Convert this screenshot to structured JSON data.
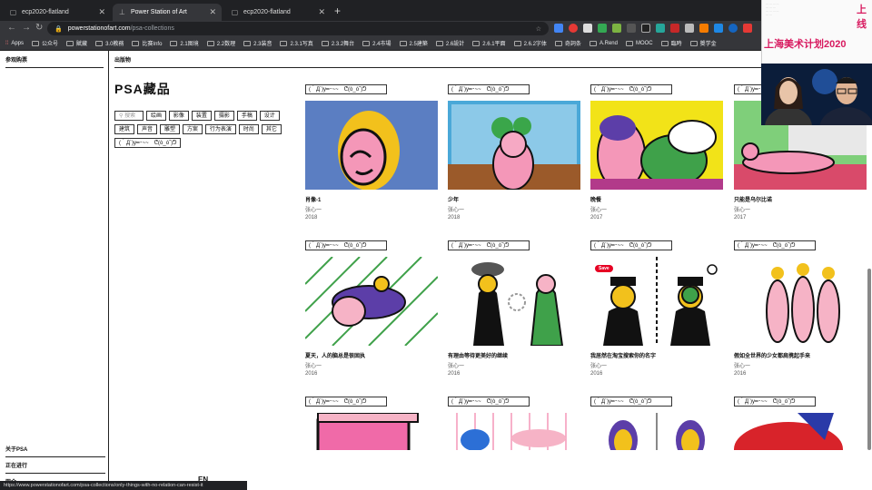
{
  "browser": {
    "tabs": [
      {
        "title": "ecp2020-flatland",
        "active": false
      },
      {
        "title": "Power Station of Art",
        "active": true
      },
      {
        "title": "ecp2020-flatland",
        "active": false
      }
    ],
    "url_host": "powerstationofart.com",
    "url_path": "/psa-collections",
    "bookmarks": [
      "Apps",
      "公众号",
      "賦藏",
      "3.0教務",
      "比赛Info",
      "2.1图境",
      "2.2数理",
      "2.3装音",
      "2.3.1写真",
      "2.3.2舞台",
      "2.4市場",
      "2.5建築",
      "2.6設計",
      "2.6.1平面",
      "2.6.2字体",
      "奇詞条",
      "A.Rend",
      "MOOC",
      "臨時",
      "獎学金"
    ],
    "status_url": "https://www.powerstationofart.com/psa-collections/only-things-with-no-relation-can-resist-it"
  },
  "sidebar": {
    "header": "参观购票",
    "bottom_items": [
      "关于PSA",
      "正在进行",
      "观众"
    ],
    "lang": "EN"
  },
  "main": {
    "section_header": "出版物",
    "page_title": "PSA藏品",
    "search_placeholder": "搜索",
    "filters": [
      "绘画",
      "影像",
      "装置",
      "摄影",
      "手稿",
      "设计",
      "建筑",
      "声音",
      "雕塑",
      "方案",
      "行为表演",
      "时尚",
      "其它"
    ],
    "filter_kaomoji": "(｀Д´)y━･~~　ᕦ(ò_óˇ)ᕤ"
  },
  "cards": [
    {
      "kaomoji": "(｀Д´)y━･~~　ᕦ(ò_óˇ)ᕤ",
      "title": "肖像-1",
      "artist": "张心一",
      "year": "2018",
      "color": "#5b7ec2"
    },
    {
      "kaomoji": "(｀Д´)y━･~~　ᕦ(ò_óˇ)ᕤ",
      "title": "少年",
      "artist": "张心一",
      "year": "2018",
      "color": "#4aa8d8"
    },
    {
      "kaomoji": "(｀Д´)y━･~~　ᕦ(ò_óˇ)ᕤ",
      "title": "晚餐",
      "artist": "张心一",
      "year": "2017",
      "color": "#f2e318"
    },
    {
      "kaomoji": "(｀Д´)y━･~~　ᕦ(ò_óˇ)ᕤ",
      "title": "只能是乌尔比诺",
      "artist": "张心一",
      "year": "2017",
      "color": "#7fcf7a"
    },
    {
      "kaomoji": "(｀Д´)y━･~~　ᕦ(ò_óˇ)ᕤ",
      "title": "夏天，人的脑总是很固执",
      "artist": "张心一",
      "year": "2016",
      "color": "#ffffff"
    },
    {
      "kaomoji": "(｀Д´)y━･~~　ᕦ(ò_óˇ)ᕤ",
      "title": "有理由等待更美好的继续",
      "artist": "张心一",
      "year": "2016",
      "color": "#ffffff"
    },
    {
      "kaomoji": "(｀Д´)y━･~~　ᕦ(ò_óˇ)ᕤ",
      "title": "我居然在淘宝搜索你的名字",
      "artist": "张心一",
      "year": "2016",
      "color": "#ffffff",
      "save_label": "Save"
    },
    {
      "kaomoji": "(｀Д´)y━･~~　ᕦ(ò_óˇ)ᕤ",
      "title": "假如全世界的少女都肩携起手来",
      "artist": "张心一",
      "year": "2016",
      "color": "#ffffff"
    },
    {
      "kaomoji": "(｀Д´)y━･~~　ᕦ(ò_óˇ)ᕤ",
      "title": "",
      "artist": "",
      "year": "",
      "color": "#f06aa8"
    },
    {
      "kaomoji": "(｀Д´)y━･~~　ᕦ(ò_óˇ)ᕤ",
      "title": "",
      "artist": "",
      "year": "",
      "color": "#ffffff"
    },
    {
      "kaomoji": "(｀Д´)y━･~~　ᕦ(ò_óˇ)ᕤ",
      "title": "",
      "artist": "",
      "year": "",
      "color": "#c9a7d6"
    },
    {
      "kaomoji": "(｀Д´)y━･~~　ᕦ(ò_óˇ)ᕤ",
      "title": "",
      "artist": "",
      "year": "",
      "color": "#d8232a"
    }
  ],
  "overlay": {
    "poster_text": "上海美术计划2020",
    "poster_side": "上线"
  }
}
